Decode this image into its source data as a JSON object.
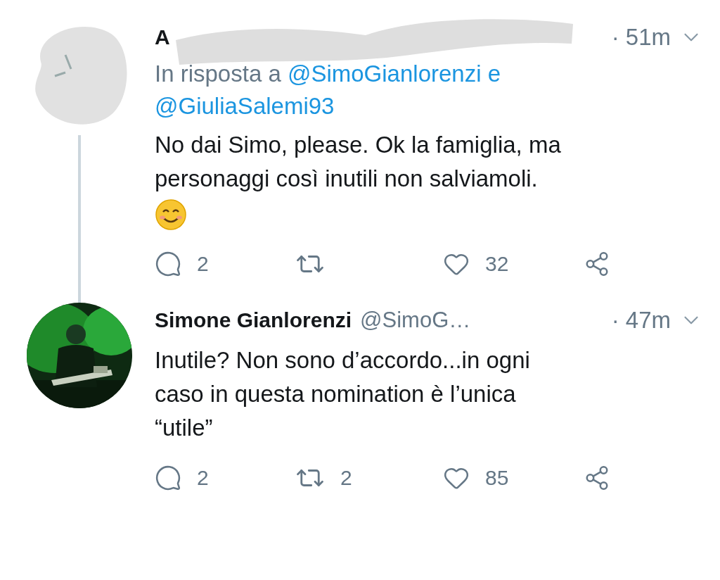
{
  "tweets": [
    {
      "avatar": {
        "kind": "scribbled"
      },
      "name": "A",
      "handle_hidden": true,
      "time": "· 51m",
      "reply_to": {
        "label": "In risposta a",
        "mentions": [
          "@SimoGianlorenzi",
          "@GiuliaSalemi93"
        ],
        "joiner": "e"
      },
      "text": "No dai Simo, please. Ok la famiglia, ma\npersonaggi così inutili non salviamoli.",
      "emoji": true,
      "thread_line": true,
      "replies": "2",
      "likes": "32"
    },
    {
      "name": "Simone Gianlorenzi",
      "handle": "@SimoG…",
      "time": "· 47m",
      "text": "Inutile? Non sono d’accordo...in ogni\ncaso in questa nomination è l’unica\n“utile”",
      "emoji": false,
      "thread_line": false,
      "replies": "2",
      "retweets": "2",
      "likes": "85"
    }
  ]
}
